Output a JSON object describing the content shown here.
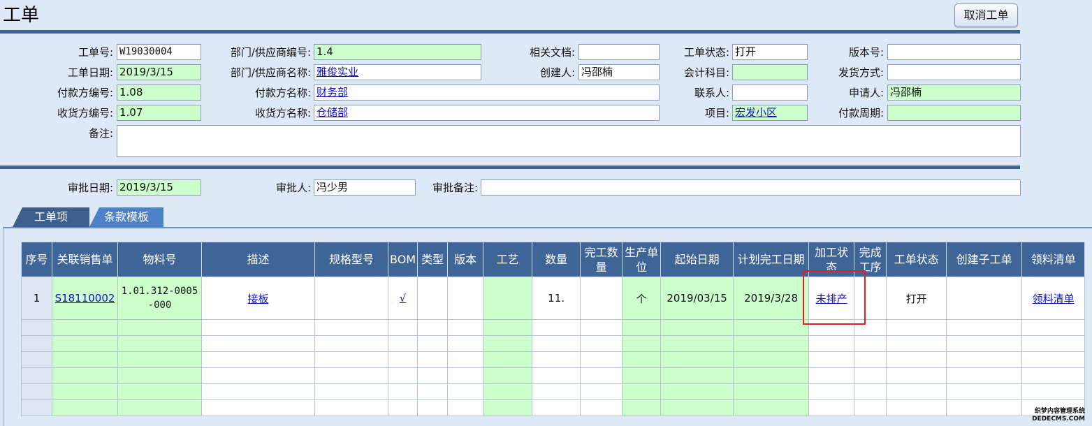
{
  "header": {
    "title": "工单",
    "cancel_label": "取消工单"
  },
  "form": {
    "order_no": {
      "label": "工单号:",
      "value": "W19030004"
    },
    "order_date": {
      "label": "工单日期:",
      "value": "2019/3/15"
    },
    "payer_no": {
      "label": "付款方编号:",
      "value": "1.08"
    },
    "receiver_no": {
      "label": "收货方编号:",
      "value": "1.07"
    },
    "remark": {
      "label": "备注:",
      "value": ""
    },
    "dept_no": {
      "label": "部门/供应商编号:",
      "value": "1.4"
    },
    "dept_name": {
      "label": "部门/供应商名称:",
      "value": "雅俊实业"
    },
    "payer_name": {
      "label": "付款方名称:",
      "value": "财务部"
    },
    "receiver_name": {
      "label": "收货方名称:",
      "value": "仓储部"
    },
    "related_doc": {
      "label": "相关文档:",
      "value": ""
    },
    "creator": {
      "label": "创建人:",
      "value": "冯邵楠"
    },
    "status": {
      "label": "工单状态:",
      "value": "打开"
    },
    "account": {
      "label": "会计科目:",
      "value": ""
    },
    "contact": {
      "label": "联系人:",
      "value": ""
    },
    "project": {
      "label": "项目:",
      "value": "宏发小区"
    },
    "version": {
      "label": "版本号:",
      "value": ""
    },
    "ship_method": {
      "label": "发货方式:",
      "value": ""
    },
    "applicant": {
      "label": "申请人:",
      "value": "冯邵楠"
    },
    "pay_cycle": {
      "label": "付款周期:",
      "value": ""
    }
  },
  "approval": {
    "date": {
      "label": "审批日期:",
      "value": "2019/3/15"
    },
    "approver": {
      "label": "审批人:",
      "value": "冯少男"
    },
    "note": {
      "label": "审批备注:",
      "value": ""
    }
  },
  "tabs": [
    {
      "label": "工单项"
    },
    {
      "label": "条款模板"
    }
  ],
  "grid": {
    "columns": [
      "序号",
      "关联销售单",
      "物料号",
      "描述",
      "规格型号",
      "BOM",
      "类型",
      "版本",
      "工艺",
      "数量",
      "完工数量",
      "生产单位",
      "起始日期",
      "计划完工日期",
      "加工状态",
      "完成工序",
      "工单状态",
      "创建子工单",
      "领料清单"
    ],
    "rows": [
      {
        "index": "1",
        "sales_order": "S18110002",
        "material_no": "1.01.312-0005-000",
        "description": "接板",
        "spec": "",
        "bom": "√",
        "type": "",
        "version": "",
        "process": "",
        "quantity": "11.",
        "done_qty": "",
        "unit": "个",
        "start_date": "2019/03/15",
        "plan_date": "2019/3/28",
        "proc_status": "未排产",
        "done_step": "",
        "order_status": "打开",
        "sub_order": "",
        "pick_list": "领料清单"
      }
    ]
  },
  "watermark": {
    "line1": "织梦内容管理系统",
    "line2": "DEDECMS.COM"
  }
}
